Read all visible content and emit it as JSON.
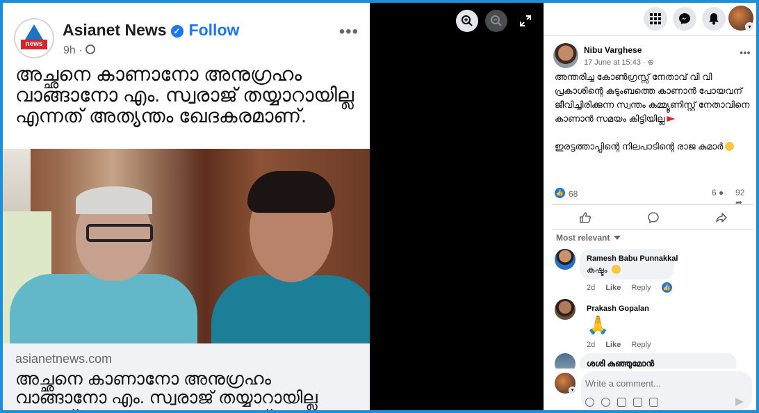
{
  "post_image": {
    "page_name": "Asianet News",
    "follow_label": "Follow",
    "time": "9h ·",
    "logo_text": "news",
    "headline": "അച്ഛനെ കാണാനോ അനുഗ്രഹം വാങ്ങാനോ എം. സ്വരാജ് തയ്യാറായില്ല എന്നത് അത്യന്തം ഖേദകരമാണ്.",
    "link_domain": "asianetnews.com",
    "link_title": "അച്ഛനെ കാണാനോ അനുഗ്രഹം വാങ്ങാനോ എം. സ്വരാജ് തയ്യാറായില്ല എന്നത് അത്യന്തം ഖേദകരമാണ്"
  },
  "viewer": {
    "zoom_in_icon": "zoom-in-icon",
    "zoom_out_icon": "zoom-out-icon",
    "expand_icon": "expand-icon"
  },
  "topbar": {
    "menu_icon": "grid-menu-icon",
    "messenger_icon": "messenger-icon",
    "notifications_icon": "bell-icon"
  },
  "post": {
    "author": "Nibu Varghese",
    "time": "17 June at 15:43 ·",
    "paragraph1": "അന്തരിച്ച കോൺഗ്രസ്സ് നേതാവ് വി വി പ്രകാശിന്റെ കുടുംബത്തെ കാണാൻ പോയവന് ജീവിച്ചിരിക്കുന്ന സ്വന്തം കമ്മ്യൂണിസ്റ്റ് നേതാവിനെ കാണാൻ സമയം കിട്ടിയില്ല",
    "paragraph2": "ഇരട്ടത്താപ്പിന്റെ നിലപാടിന്റെ രാജ കുമാർ",
    "likes": "68",
    "comments": "6",
    "shares": "92"
  },
  "comments_header": "Most relevant",
  "comments": [
    {
      "name": "Ramesh Babu Punnakkal",
      "text": "കഷ്ടം",
      "age": "2d",
      "like": "Like",
      "reply": "Reply"
    },
    {
      "name": "Prakash Gopalan",
      "text": "🙏",
      "age": "2d",
      "like": "Like",
      "reply": "Reply"
    },
    {
      "name": "ശശി കുഞ്ഞുമോൻ",
      "text": ""
    }
  ],
  "composer": {
    "placeholder": "Write a comment..."
  },
  "colors": {
    "frame": "#1b8fd8",
    "facebook_blue": "#1877f2"
  }
}
